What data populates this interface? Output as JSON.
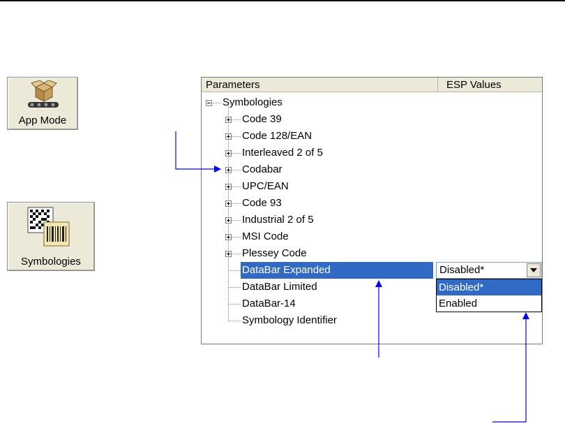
{
  "toolbar": {
    "app_mode_label": "App Mode",
    "symbologies_label": "Symbologies"
  },
  "tree": {
    "col_parameters": "Parameters",
    "col_esp_values": "ESP Values",
    "root": "Symbologies",
    "expandable_items": [
      "Code 39",
      "Code 128/EAN",
      "Interleaved 2 of 5",
      "Codabar",
      "UPC/EAN",
      "Code 93",
      "Industrial 2 of 5",
      "MSI Code",
      "Plessey Code"
    ],
    "leaf_items": [
      "DataBar Expanded",
      "DataBar Limited",
      "DataBar-14",
      "Symbology Identifier"
    ],
    "selected_item": "DataBar Expanded"
  },
  "combo": {
    "value": "Disabled*",
    "options": [
      "Disabled*",
      "Enabled"
    ],
    "highlighted_option": "Disabled*"
  },
  "colors": {
    "selection": "#316ac5",
    "arrow": "#0000ff",
    "toolbar_bg": "#ece9d8"
  },
  "icons": {
    "app_mode": "box-on-conveyor-icon",
    "symbologies": "barcode-datamatrix-icon",
    "dropdown": "chevron-down-icon"
  }
}
